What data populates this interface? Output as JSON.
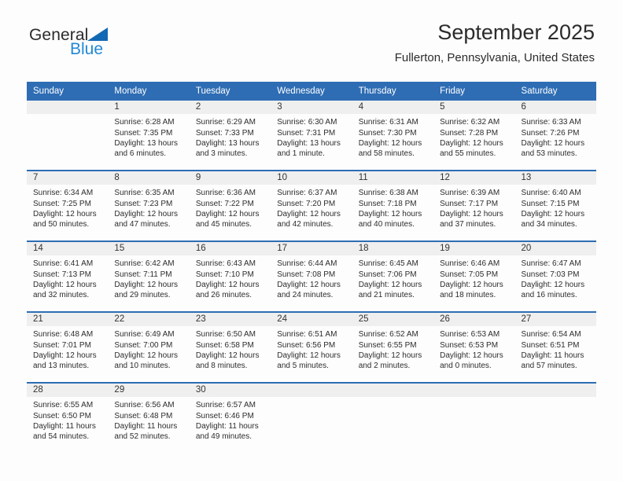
{
  "logo": {
    "word1": "General",
    "word2": "Blue",
    "triangle_color": "#1268b3",
    "blue_text_color": "#2288d6"
  },
  "header": {
    "title": "September 2025",
    "subtitle": "Fullerton, Pennsylvania, United States",
    "accent_color": "#2e6db4"
  },
  "calendar": {
    "weekday_headers": [
      "Sunday",
      "Monday",
      "Tuesday",
      "Wednesday",
      "Thursday",
      "Friday",
      "Saturday"
    ],
    "weeks": [
      [
        {
          "empty": true
        },
        {
          "day": "1",
          "sunrise": "Sunrise: 6:28 AM",
          "sunset": "Sunset: 7:35 PM",
          "daylight_l1": "Daylight: 13 hours",
          "daylight_l2": "and 6 minutes."
        },
        {
          "day": "2",
          "sunrise": "Sunrise: 6:29 AM",
          "sunset": "Sunset: 7:33 PM",
          "daylight_l1": "Daylight: 13 hours",
          "daylight_l2": "and 3 minutes."
        },
        {
          "day": "3",
          "sunrise": "Sunrise: 6:30 AM",
          "sunset": "Sunset: 7:31 PM",
          "daylight_l1": "Daylight: 13 hours",
          "daylight_l2": "and 1 minute."
        },
        {
          "day": "4",
          "sunrise": "Sunrise: 6:31 AM",
          "sunset": "Sunset: 7:30 PM",
          "daylight_l1": "Daylight: 12 hours",
          "daylight_l2": "and 58 minutes."
        },
        {
          "day": "5",
          "sunrise": "Sunrise: 6:32 AM",
          "sunset": "Sunset: 7:28 PM",
          "daylight_l1": "Daylight: 12 hours",
          "daylight_l2": "and 55 minutes."
        },
        {
          "day": "6",
          "sunrise": "Sunrise: 6:33 AM",
          "sunset": "Sunset: 7:26 PM",
          "daylight_l1": "Daylight: 12 hours",
          "daylight_l2": "and 53 minutes."
        }
      ],
      [
        {
          "day": "7",
          "sunrise": "Sunrise: 6:34 AM",
          "sunset": "Sunset: 7:25 PM",
          "daylight_l1": "Daylight: 12 hours",
          "daylight_l2": "and 50 minutes."
        },
        {
          "day": "8",
          "sunrise": "Sunrise: 6:35 AM",
          "sunset": "Sunset: 7:23 PM",
          "daylight_l1": "Daylight: 12 hours",
          "daylight_l2": "and 47 minutes."
        },
        {
          "day": "9",
          "sunrise": "Sunrise: 6:36 AM",
          "sunset": "Sunset: 7:22 PM",
          "daylight_l1": "Daylight: 12 hours",
          "daylight_l2": "and 45 minutes."
        },
        {
          "day": "10",
          "sunrise": "Sunrise: 6:37 AM",
          "sunset": "Sunset: 7:20 PM",
          "daylight_l1": "Daylight: 12 hours",
          "daylight_l2": "and 42 minutes."
        },
        {
          "day": "11",
          "sunrise": "Sunrise: 6:38 AM",
          "sunset": "Sunset: 7:18 PM",
          "daylight_l1": "Daylight: 12 hours",
          "daylight_l2": "and 40 minutes."
        },
        {
          "day": "12",
          "sunrise": "Sunrise: 6:39 AM",
          "sunset": "Sunset: 7:17 PM",
          "daylight_l1": "Daylight: 12 hours",
          "daylight_l2": "and 37 minutes."
        },
        {
          "day": "13",
          "sunrise": "Sunrise: 6:40 AM",
          "sunset": "Sunset: 7:15 PM",
          "daylight_l1": "Daylight: 12 hours",
          "daylight_l2": "and 34 minutes."
        }
      ],
      [
        {
          "day": "14",
          "sunrise": "Sunrise: 6:41 AM",
          "sunset": "Sunset: 7:13 PM",
          "daylight_l1": "Daylight: 12 hours",
          "daylight_l2": "and 32 minutes."
        },
        {
          "day": "15",
          "sunrise": "Sunrise: 6:42 AM",
          "sunset": "Sunset: 7:11 PM",
          "daylight_l1": "Daylight: 12 hours",
          "daylight_l2": "and 29 minutes."
        },
        {
          "day": "16",
          "sunrise": "Sunrise: 6:43 AM",
          "sunset": "Sunset: 7:10 PM",
          "daylight_l1": "Daylight: 12 hours",
          "daylight_l2": "and 26 minutes."
        },
        {
          "day": "17",
          "sunrise": "Sunrise: 6:44 AM",
          "sunset": "Sunset: 7:08 PM",
          "daylight_l1": "Daylight: 12 hours",
          "daylight_l2": "and 24 minutes."
        },
        {
          "day": "18",
          "sunrise": "Sunrise: 6:45 AM",
          "sunset": "Sunset: 7:06 PM",
          "daylight_l1": "Daylight: 12 hours",
          "daylight_l2": "and 21 minutes."
        },
        {
          "day": "19",
          "sunrise": "Sunrise: 6:46 AM",
          "sunset": "Sunset: 7:05 PM",
          "daylight_l1": "Daylight: 12 hours",
          "daylight_l2": "and 18 minutes."
        },
        {
          "day": "20",
          "sunrise": "Sunrise: 6:47 AM",
          "sunset": "Sunset: 7:03 PM",
          "daylight_l1": "Daylight: 12 hours",
          "daylight_l2": "and 16 minutes."
        }
      ],
      [
        {
          "day": "21",
          "sunrise": "Sunrise: 6:48 AM",
          "sunset": "Sunset: 7:01 PM",
          "daylight_l1": "Daylight: 12 hours",
          "daylight_l2": "and 13 minutes."
        },
        {
          "day": "22",
          "sunrise": "Sunrise: 6:49 AM",
          "sunset": "Sunset: 7:00 PM",
          "daylight_l1": "Daylight: 12 hours",
          "daylight_l2": "and 10 minutes."
        },
        {
          "day": "23",
          "sunrise": "Sunrise: 6:50 AM",
          "sunset": "Sunset: 6:58 PM",
          "daylight_l1": "Daylight: 12 hours",
          "daylight_l2": "and 8 minutes."
        },
        {
          "day": "24",
          "sunrise": "Sunrise: 6:51 AM",
          "sunset": "Sunset: 6:56 PM",
          "daylight_l1": "Daylight: 12 hours",
          "daylight_l2": "and 5 minutes."
        },
        {
          "day": "25",
          "sunrise": "Sunrise: 6:52 AM",
          "sunset": "Sunset: 6:55 PM",
          "daylight_l1": "Daylight: 12 hours",
          "daylight_l2": "and 2 minutes."
        },
        {
          "day": "26",
          "sunrise": "Sunrise: 6:53 AM",
          "sunset": "Sunset: 6:53 PM",
          "daylight_l1": "Daylight: 12 hours",
          "daylight_l2": "and 0 minutes."
        },
        {
          "day": "27",
          "sunrise": "Sunrise: 6:54 AM",
          "sunset": "Sunset: 6:51 PM",
          "daylight_l1": "Daylight: 11 hours",
          "daylight_l2": "and 57 minutes."
        }
      ],
      [
        {
          "day": "28",
          "sunrise": "Sunrise: 6:55 AM",
          "sunset": "Sunset: 6:50 PM",
          "daylight_l1": "Daylight: 11 hours",
          "daylight_l2": "and 54 minutes."
        },
        {
          "day": "29",
          "sunrise": "Sunrise: 6:56 AM",
          "sunset": "Sunset: 6:48 PM",
          "daylight_l1": "Daylight: 11 hours",
          "daylight_l2": "and 52 minutes."
        },
        {
          "day": "30",
          "sunrise": "Sunrise: 6:57 AM",
          "sunset": "Sunset: 6:46 PM",
          "daylight_l1": "Daylight: 11 hours",
          "daylight_l2": "and 49 minutes."
        },
        {
          "empty": true
        },
        {
          "empty": true
        },
        {
          "empty": true
        },
        {
          "empty": true
        }
      ]
    ]
  }
}
